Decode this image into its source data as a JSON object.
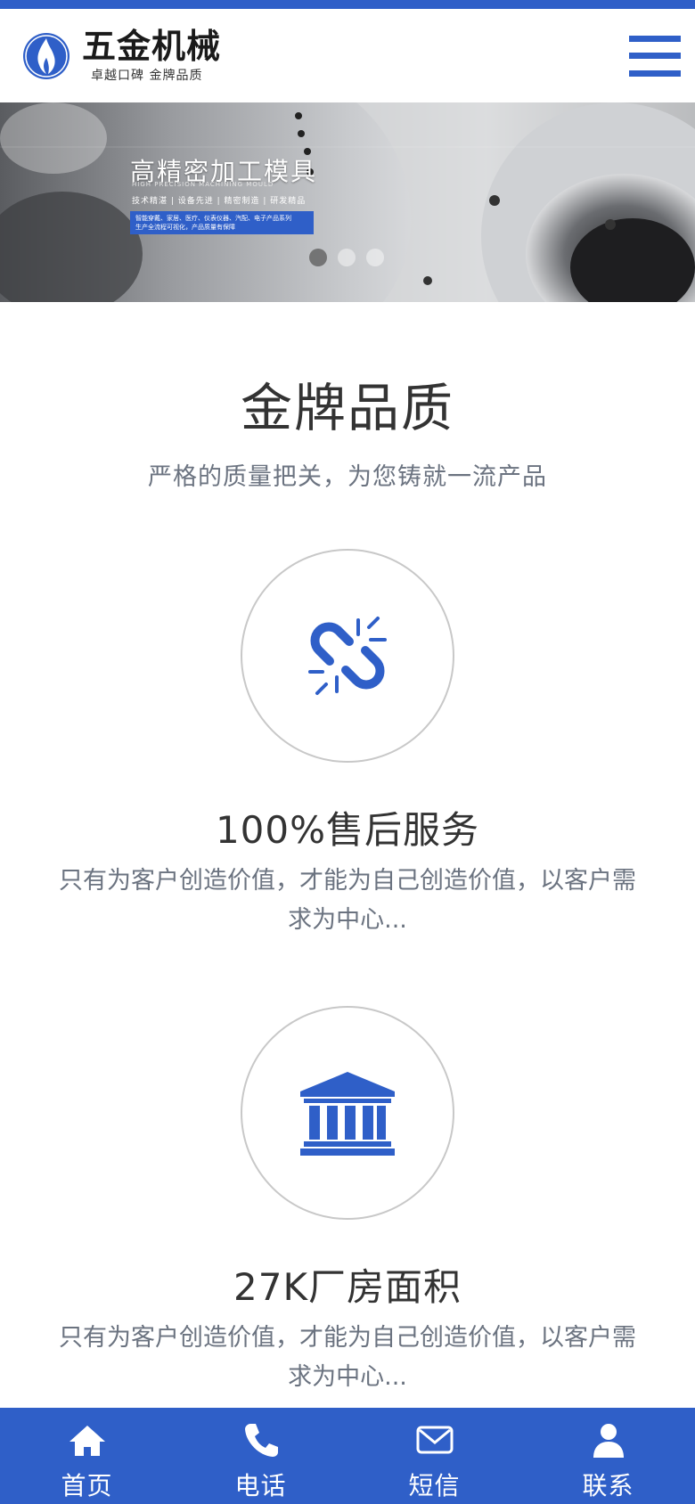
{
  "header": {
    "logo_title": "五金机械",
    "logo_sub": "卓越口碑 金牌品质"
  },
  "banner": {
    "title": "高精密加工模具",
    "subtitle_en": "HIGH PRECISION MACHINING MOULD",
    "tags": "技术精湛 | 设备先进 | 精密制造 | 研发精品",
    "box_line1": "智能穿戴、家居、医疗、仪表仪器、汽配、电子产品系列",
    "box_line2": "生产全流程可视化，产品质量有保障",
    "slides": 3,
    "active_slide": 1
  },
  "section": {
    "title": "金牌品质",
    "subtitle": "严格的质量把关，为您铸就一流产品"
  },
  "features": [
    {
      "icon": "broken-link-icon",
      "title": "100%售后服务",
      "desc": "只有为客户创造价值，才能为自己创造价值，以客户需求为中心..."
    },
    {
      "icon": "bank-building-icon",
      "title": "27K厂房面积",
      "desc": "只有为客户创造价值，才能为自己创造价值，以客户需求为中心..."
    }
  ],
  "bottom_nav": [
    {
      "icon": "home-icon",
      "label": "首页"
    },
    {
      "icon": "phone-icon",
      "label": "电话"
    },
    {
      "icon": "mail-icon",
      "label": "短信"
    },
    {
      "icon": "user-icon",
      "label": "联系"
    }
  ],
  "colors": {
    "primary": "#2f5fc8",
    "text_dark": "#333333",
    "text_muted": "#6b7380"
  }
}
